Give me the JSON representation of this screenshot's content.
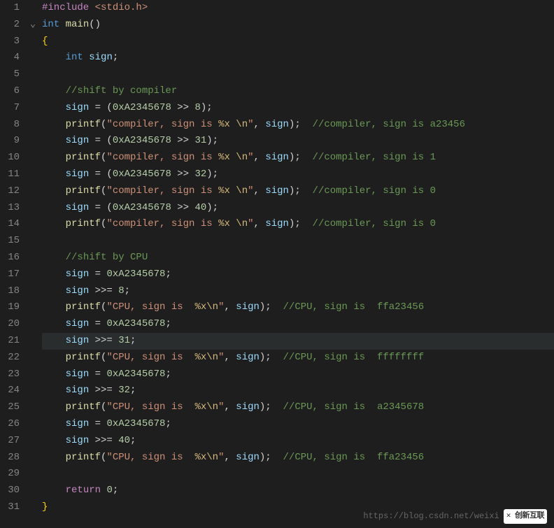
{
  "editor": {
    "active_line": 21,
    "fold_marker_line": 2,
    "lines": [
      {
        "n": 1,
        "tokens": [
          {
            "c": "kw-control",
            "t": "#include"
          },
          {
            "c": "op",
            "t": " "
          },
          {
            "c": "str",
            "t": "<stdio.h>"
          }
        ]
      },
      {
        "n": 2,
        "tokens": [
          {
            "c": "kw-type",
            "t": "int"
          },
          {
            "c": "op",
            "t": " "
          },
          {
            "c": "func",
            "t": "main"
          },
          {
            "c": "punct",
            "t": "()"
          }
        ]
      },
      {
        "n": 3,
        "tokens": [
          {
            "c": "brace",
            "t": "{"
          }
        ]
      },
      {
        "n": 4,
        "tokens": [
          {
            "c": "op",
            "t": "    "
          },
          {
            "c": "kw-type",
            "t": "int"
          },
          {
            "c": "op",
            "t": " "
          },
          {
            "c": "var",
            "t": "sign"
          },
          {
            "c": "punct",
            "t": ";"
          }
        ]
      },
      {
        "n": 5,
        "tokens": []
      },
      {
        "n": 6,
        "tokens": [
          {
            "c": "op",
            "t": "    "
          },
          {
            "c": "comment",
            "t": "//shift by compiler"
          }
        ]
      },
      {
        "n": 7,
        "tokens": [
          {
            "c": "op",
            "t": "    "
          },
          {
            "c": "var",
            "t": "sign"
          },
          {
            "c": "op",
            "t": " = ("
          },
          {
            "c": "num",
            "t": "0xA2345678"
          },
          {
            "c": "op",
            "t": " >> "
          },
          {
            "c": "num",
            "t": "8"
          },
          {
            "c": "op",
            "t": ");"
          }
        ]
      },
      {
        "n": 8,
        "tokens": [
          {
            "c": "op",
            "t": "    "
          },
          {
            "c": "func",
            "t": "printf"
          },
          {
            "c": "punct",
            "t": "("
          },
          {
            "c": "str",
            "t": "\"compiler, sign is "
          },
          {
            "c": "esc",
            "t": "%x"
          },
          {
            "c": "str",
            "t": " "
          },
          {
            "c": "esc",
            "t": "\\n"
          },
          {
            "c": "str",
            "t": "\""
          },
          {
            "c": "punct",
            "t": ", "
          },
          {
            "c": "var",
            "t": "sign"
          },
          {
            "c": "punct",
            "t": ");  "
          },
          {
            "c": "comment",
            "t": "//compiler, sign is a23456"
          }
        ]
      },
      {
        "n": 9,
        "tokens": [
          {
            "c": "op",
            "t": "    "
          },
          {
            "c": "var",
            "t": "sign"
          },
          {
            "c": "op",
            "t": " = ("
          },
          {
            "c": "num",
            "t": "0xA2345678"
          },
          {
            "c": "op",
            "t": " >> "
          },
          {
            "c": "num",
            "t": "31"
          },
          {
            "c": "op",
            "t": ");"
          }
        ]
      },
      {
        "n": 10,
        "tokens": [
          {
            "c": "op",
            "t": "    "
          },
          {
            "c": "func",
            "t": "printf"
          },
          {
            "c": "punct",
            "t": "("
          },
          {
            "c": "str",
            "t": "\"compiler, sign is "
          },
          {
            "c": "esc",
            "t": "%x"
          },
          {
            "c": "str",
            "t": " "
          },
          {
            "c": "esc",
            "t": "\\n"
          },
          {
            "c": "str",
            "t": "\""
          },
          {
            "c": "punct",
            "t": ", "
          },
          {
            "c": "var",
            "t": "sign"
          },
          {
            "c": "punct",
            "t": ");  "
          },
          {
            "c": "comment",
            "t": "//compiler, sign is 1"
          }
        ]
      },
      {
        "n": 11,
        "tokens": [
          {
            "c": "op",
            "t": "    "
          },
          {
            "c": "var",
            "t": "sign"
          },
          {
            "c": "op",
            "t": " = ("
          },
          {
            "c": "num",
            "t": "0xA2345678"
          },
          {
            "c": "op",
            "t": " >> "
          },
          {
            "c": "num",
            "t": "32"
          },
          {
            "c": "op",
            "t": ");"
          }
        ]
      },
      {
        "n": 12,
        "tokens": [
          {
            "c": "op",
            "t": "    "
          },
          {
            "c": "func",
            "t": "printf"
          },
          {
            "c": "punct",
            "t": "("
          },
          {
            "c": "str",
            "t": "\"compiler, sign is "
          },
          {
            "c": "esc",
            "t": "%x"
          },
          {
            "c": "str",
            "t": " "
          },
          {
            "c": "esc",
            "t": "\\n"
          },
          {
            "c": "str",
            "t": "\""
          },
          {
            "c": "punct",
            "t": ", "
          },
          {
            "c": "var",
            "t": "sign"
          },
          {
            "c": "punct",
            "t": ");  "
          },
          {
            "c": "comment",
            "t": "//compiler, sign is 0"
          }
        ]
      },
      {
        "n": 13,
        "tokens": [
          {
            "c": "op",
            "t": "    "
          },
          {
            "c": "var",
            "t": "sign"
          },
          {
            "c": "op",
            "t": " = ("
          },
          {
            "c": "num",
            "t": "0xA2345678"
          },
          {
            "c": "op",
            "t": " >> "
          },
          {
            "c": "num",
            "t": "40"
          },
          {
            "c": "op",
            "t": ");"
          }
        ]
      },
      {
        "n": 14,
        "tokens": [
          {
            "c": "op",
            "t": "    "
          },
          {
            "c": "func",
            "t": "printf"
          },
          {
            "c": "punct",
            "t": "("
          },
          {
            "c": "str",
            "t": "\"compiler, sign is "
          },
          {
            "c": "esc",
            "t": "%x"
          },
          {
            "c": "str",
            "t": " "
          },
          {
            "c": "esc",
            "t": "\\n"
          },
          {
            "c": "str",
            "t": "\""
          },
          {
            "c": "punct",
            "t": ", "
          },
          {
            "c": "var",
            "t": "sign"
          },
          {
            "c": "punct",
            "t": ");  "
          },
          {
            "c": "comment",
            "t": "//compiler, sign is 0"
          }
        ]
      },
      {
        "n": 15,
        "tokens": []
      },
      {
        "n": 16,
        "tokens": [
          {
            "c": "op",
            "t": "    "
          },
          {
            "c": "comment",
            "t": "//shift by CPU"
          }
        ]
      },
      {
        "n": 17,
        "tokens": [
          {
            "c": "op",
            "t": "    "
          },
          {
            "c": "var",
            "t": "sign"
          },
          {
            "c": "op",
            "t": " = "
          },
          {
            "c": "num",
            "t": "0xA2345678"
          },
          {
            "c": "op",
            "t": ";"
          }
        ]
      },
      {
        "n": 18,
        "tokens": [
          {
            "c": "op",
            "t": "    "
          },
          {
            "c": "var",
            "t": "sign"
          },
          {
            "c": "op",
            "t": " >>= "
          },
          {
            "c": "num",
            "t": "8"
          },
          {
            "c": "op",
            "t": ";"
          }
        ]
      },
      {
        "n": 19,
        "tokens": [
          {
            "c": "op",
            "t": "    "
          },
          {
            "c": "func",
            "t": "printf"
          },
          {
            "c": "punct",
            "t": "("
          },
          {
            "c": "str",
            "t": "\"CPU, sign is  "
          },
          {
            "c": "esc",
            "t": "%x\\n"
          },
          {
            "c": "str",
            "t": "\""
          },
          {
            "c": "punct",
            "t": ", "
          },
          {
            "c": "var",
            "t": "sign"
          },
          {
            "c": "punct",
            "t": ");  "
          },
          {
            "c": "comment",
            "t": "//CPU, sign is  ffa23456"
          }
        ]
      },
      {
        "n": 20,
        "tokens": [
          {
            "c": "op",
            "t": "    "
          },
          {
            "c": "var",
            "t": "sign"
          },
          {
            "c": "op",
            "t": " = "
          },
          {
            "c": "num",
            "t": "0xA2345678"
          },
          {
            "c": "op",
            "t": ";"
          }
        ]
      },
      {
        "n": 21,
        "tokens": [
          {
            "c": "op",
            "t": "    "
          },
          {
            "c": "var",
            "t": "sign"
          },
          {
            "c": "op",
            "t": " >>= "
          },
          {
            "c": "num",
            "t": "31"
          },
          {
            "c": "op",
            "t": ";"
          }
        ]
      },
      {
        "n": 22,
        "tokens": [
          {
            "c": "op",
            "t": "    "
          },
          {
            "c": "func",
            "t": "printf"
          },
          {
            "c": "punct",
            "t": "("
          },
          {
            "c": "str",
            "t": "\"CPU, sign is  "
          },
          {
            "c": "esc",
            "t": "%x\\n"
          },
          {
            "c": "str",
            "t": "\""
          },
          {
            "c": "punct",
            "t": ", "
          },
          {
            "c": "var",
            "t": "sign"
          },
          {
            "c": "punct",
            "t": ");  "
          },
          {
            "c": "comment",
            "t": "//CPU, sign is  ffffffff"
          }
        ]
      },
      {
        "n": 23,
        "tokens": [
          {
            "c": "op",
            "t": "    "
          },
          {
            "c": "var",
            "t": "sign"
          },
          {
            "c": "op",
            "t": " = "
          },
          {
            "c": "num",
            "t": "0xA2345678"
          },
          {
            "c": "op",
            "t": ";"
          }
        ]
      },
      {
        "n": 24,
        "tokens": [
          {
            "c": "op",
            "t": "    "
          },
          {
            "c": "var",
            "t": "sign"
          },
          {
            "c": "op",
            "t": " >>= "
          },
          {
            "c": "num",
            "t": "32"
          },
          {
            "c": "op",
            "t": ";"
          }
        ]
      },
      {
        "n": 25,
        "tokens": [
          {
            "c": "op",
            "t": "    "
          },
          {
            "c": "func",
            "t": "printf"
          },
          {
            "c": "punct",
            "t": "("
          },
          {
            "c": "str",
            "t": "\"CPU, sign is  "
          },
          {
            "c": "esc",
            "t": "%x\\n"
          },
          {
            "c": "str",
            "t": "\""
          },
          {
            "c": "punct",
            "t": ", "
          },
          {
            "c": "var",
            "t": "sign"
          },
          {
            "c": "punct",
            "t": ");  "
          },
          {
            "c": "comment",
            "t": "//CPU, sign is  a2345678"
          }
        ]
      },
      {
        "n": 26,
        "tokens": [
          {
            "c": "op",
            "t": "    "
          },
          {
            "c": "var",
            "t": "sign"
          },
          {
            "c": "op",
            "t": " = "
          },
          {
            "c": "num",
            "t": "0xA2345678"
          },
          {
            "c": "op",
            "t": ";"
          }
        ]
      },
      {
        "n": 27,
        "tokens": [
          {
            "c": "op",
            "t": "    "
          },
          {
            "c": "var",
            "t": "sign"
          },
          {
            "c": "op",
            "t": " >>= "
          },
          {
            "c": "num",
            "t": "40"
          },
          {
            "c": "op",
            "t": ";"
          }
        ]
      },
      {
        "n": 28,
        "tokens": [
          {
            "c": "op",
            "t": "    "
          },
          {
            "c": "func",
            "t": "printf"
          },
          {
            "c": "punct",
            "t": "("
          },
          {
            "c": "str",
            "t": "\"CPU, sign is  "
          },
          {
            "c": "esc",
            "t": "%x\\n"
          },
          {
            "c": "str",
            "t": "\""
          },
          {
            "c": "punct",
            "t": ", "
          },
          {
            "c": "var",
            "t": "sign"
          },
          {
            "c": "punct",
            "t": ");  "
          },
          {
            "c": "comment",
            "t": "//CPU, sign is  ffa23456"
          }
        ]
      },
      {
        "n": 29,
        "tokens": []
      },
      {
        "n": 30,
        "tokens": [
          {
            "c": "op",
            "t": "    "
          },
          {
            "c": "kw-control",
            "t": "return"
          },
          {
            "c": "op",
            "t": " "
          },
          {
            "c": "num",
            "t": "0"
          },
          {
            "c": "op",
            "t": ";"
          }
        ]
      },
      {
        "n": 31,
        "tokens": [
          {
            "c": "brace",
            "t": "}"
          }
        ]
      }
    ]
  },
  "watermark": {
    "url": "https://blog.csdn.net/weixi",
    "logo": "创新互联"
  }
}
